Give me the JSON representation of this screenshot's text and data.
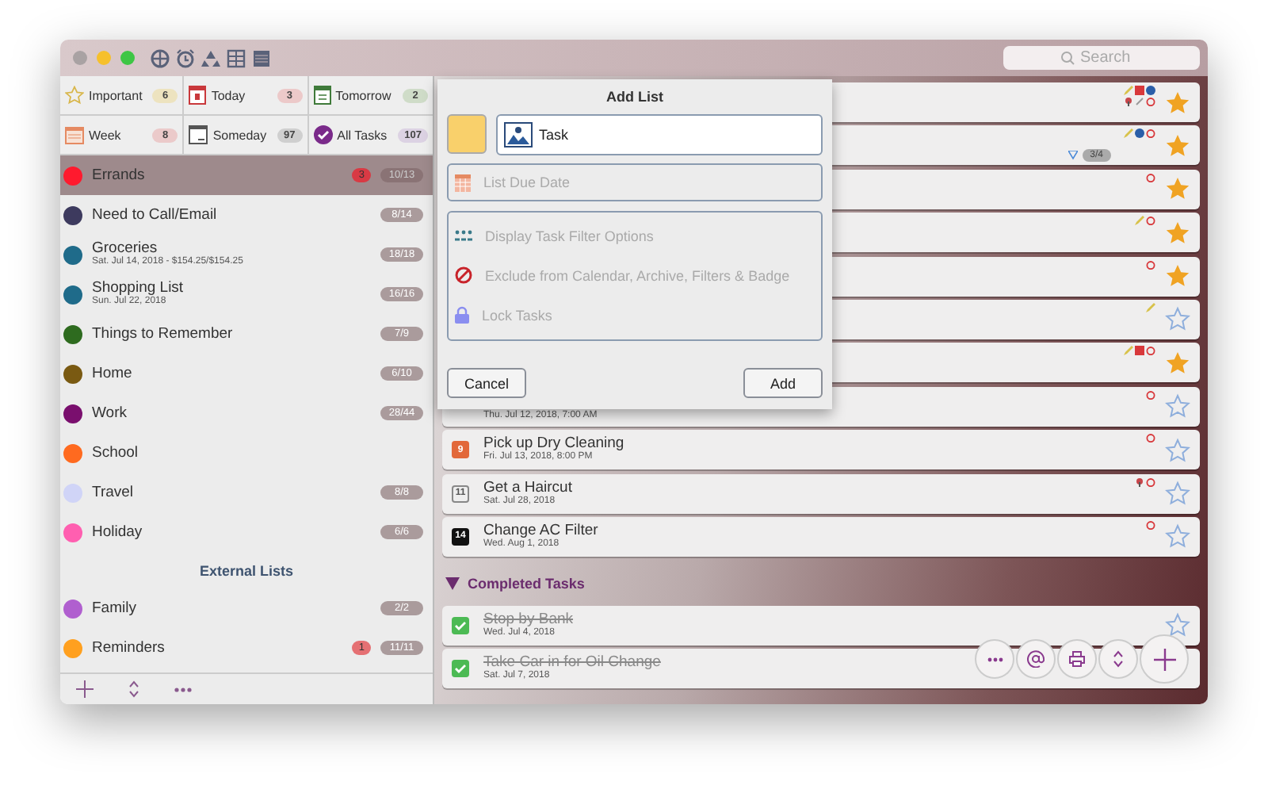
{
  "search": {
    "placeholder": "Search"
  },
  "filters": [
    {
      "kind": "important",
      "label": "Important",
      "count": "6",
      "color": "#ede3bf"
    },
    {
      "kind": "today",
      "label": "Today",
      "count": "3",
      "color": "#ecc9c9"
    },
    {
      "kind": "tomorrow",
      "label": "Tomorrow",
      "count": "2",
      "color": "#cfdcc8"
    },
    {
      "kind": "week",
      "label": "Week",
      "count": "8",
      "color": "#ebcaca"
    },
    {
      "kind": "someday",
      "label": "Someday",
      "count": "97",
      "color": "#cfcfcf"
    },
    {
      "kind": "all",
      "label": "All Tasks",
      "count": "107",
      "color": "#dcd2e3"
    }
  ],
  "lists": [
    {
      "name": "Errands",
      "color": "#ff1a2e",
      "overdue": "3",
      "count": "10/13",
      "selected": true
    },
    {
      "name": "Need to Call/Email",
      "color": "#3d3a5e",
      "count": "8/14",
      "selected": false
    },
    {
      "name": "Groceries",
      "subtitle": "Sat. Jul 14, 2018 - $154.25/$154.25",
      "color": "#1f6b8a",
      "count": "18/18",
      "selected": false
    },
    {
      "name": "Shopping List",
      "subtitle": "Sun. Jul 22, 2018",
      "color": "#1f6b8a",
      "count": "16/16",
      "selected": false
    },
    {
      "name": "Things to Remember",
      "color": "#2e6b1f",
      "count": "7/9",
      "selected": false
    },
    {
      "name": "Home",
      "color": "#7a5a12",
      "count": "6/10",
      "selected": false
    },
    {
      "name": "Work",
      "color": "#7a0f6e",
      "count": "28/44",
      "selected": false
    },
    {
      "name": "School",
      "color": "#ff6a1f",
      "selected": false
    },
    {
      "name": "Travel",
      "color": "#d0d4f7",
      "count": "8/8",
      "selected": false
    },
    {
      "name": "Holiday",
      "color": "#ff5fb0",
      "count": "6/6",
      "selected": false
    }
  ],
  "external_header": "External Lists",
  "external_lists": [
    {
      "name": "Family",
      "color": "#b05fcf",
      "count": "2/2",
      "selected": false
    },
    {
      "name": "Reminders",
      "color": "#ffa01f",
      "overdue": "1",
      "count": "11/11",
      "selected": false
    }
  ],
  "tasks": [
    {
      "starred": true,
      "note": true,
      "calendar": true,
      "globe": true,
      "location": true,
      "attachment": true,
      "alarm": true
    },
    {
      "starred": true,
      "note": true,
      "globe": true,
      "alarm": true,
      "progress": "3/4"
    },
    {
      "starred": true,
      "alarm": true
    },
    {
      "starred": true,
      "note": true,
      "alarm": true
    },
    {
      "starred": true,
      "alarm": true
    },
    {
      "starred": false,
      "note": true
    },
    {
      "starred": true,
      "note": true,
      "calendar": true,
      "alarm": true
    },
    {
      "subtitle": "Thu. Jul 12, 2018, 7:00 AM",
      "starred": false,
      "alarm": true
    },
    {
      "title": "Pick up Dry Cleaning",
      "subtitle": "Fri. Jul 13, 2018, 8:00 PM",
      "day": "9",
      "kind": "overdue",
      "starred": false,
      "alarm": true
    },
    {
      "title": "Get a Haircut",
      "subtitle": "Sat. Jul 28, 2018",
      "day": "11",
      "kind": "later",
      "starred": false,
      "location": true,
      "alarm": true
    },
    {
      "title": "Change AC Filter",
      "subtitle": "Wed. Aug 1, 2018",
      "day": "14",
      "kind": "dark",
      "starred": false,
      "alarm": true
    }
  ],
  "completed_section": {
    "label": "Completed Tasks",
    "expanded": true
  },
  "completed_tasks": [
    {
      "title": "Stop by Bank",
      "subtitle": "Wed. Jul 4, 2018",
      "completed": true,
      "starred": false
    },
    {
      "title": "Take Car in for Oil Change",
      "subtitle": "Sat. Jul 7, 2018",
      "completed": true
    }
  ],
  "dialog": {
    "title": "Add List",
    "color": "#f9d06b",
    "name_value": "Task",
    "due_placeholder": "List Due Date",
    "options": [
      {
        "kind": "filter",
        "label": "Display Task Filter Options",
        "disabled": true
      },
      {
        "kind": "exclude",
        "label": "Exclude from Calendar, Archive, Filters & Badge",
        "disabled": true
      },
      {
        "kind": "lock",
        "label": "Lock Tasks",
        "disabled": true
      }
    ],
    "buttons": [
      "Cancel",
      "Add"
    ]
  }
}
